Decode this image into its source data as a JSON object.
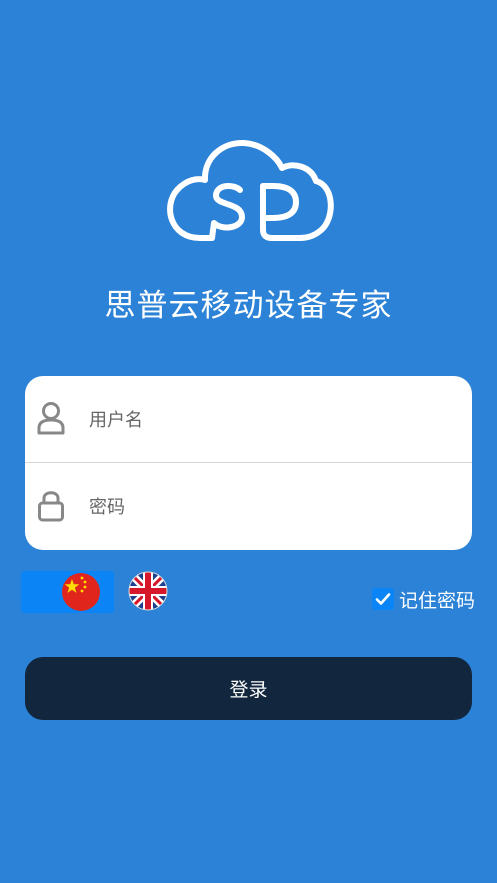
{
  "logo": {
    "text": "SP",
    "icon": "cloud-logo-icon"
  },
  "app_title": "思普云移动设备专家",
  "username": {
    "placeholder": "用户名",
    "value": "",
    "icon": "user-icon"
  },
  "password": {
    "placeholder": "密码",
    "value": "",
    "icon": "lock-icon"
  },
  "language": {
    "options": [
      {
        "name": "chinese-flag-icon",
        "selected": true
      },
      {
        "name": "uk-flag-icon",
        "selected": false
      }
    ],
    "selected_color": "#0b84f5"
  },
  "remember": {
    "label": "记住密码",
    "checked": true
  },
  "login_button": {
    "label": "登录"
  },
  "colors": {
    "background": "#2b82d6",
    "button": "#12263d",
    "card": "#ffffff",
    "accent": "#0b84f5"
  }
}
